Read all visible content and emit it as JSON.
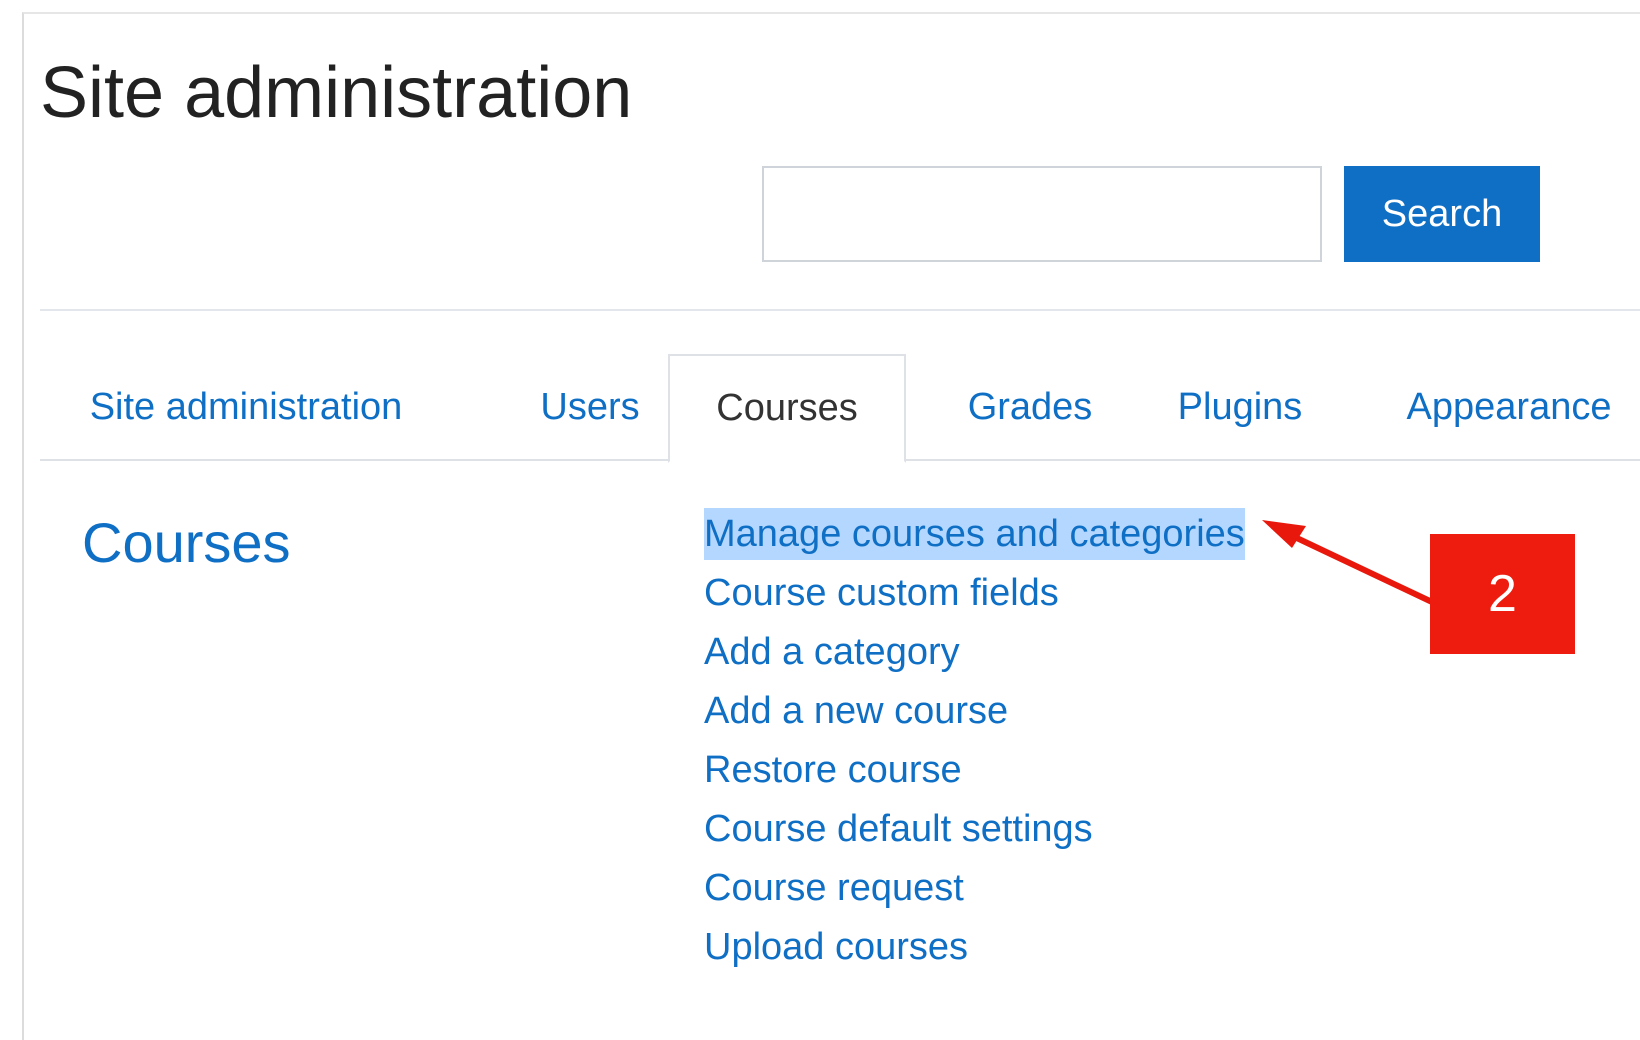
{
  "page": {
    "title": "Site administration"
  },
  "search": {
    "value": "",
    "placeholder": "",
    "button_label": "Search"
  },
  "tabs": [
    {
      "label": "Site administration",
      "active": false
    },
    {
      "label": "Users",
      "active": false
    },
    {
      "label": "Courses",
      "active": true
    },
    {
      "label": "Grades",
      "active": false
    },
    {
      "label": "Plugins",
      "active": false
    },
    {
      "label": "Appearance",
      "active": false
    }
  ],
  "section": {
    "heading": "Courses",
    "links": [
      {
        "label": "Manage courses and categories",
        "highlighted": true
      },
      {
        "label": "Course custom fields"
      },
      {
        "label": "Add a category"
      },
      {
        "label": "Add a new course"
      },
      {
        "label": "Restore course"
      },
      {
        "label": "Course default settings"
      },
      {
        "label": "Course request"
      },
      {
        "label": "Upload courses"
      }
    ]
  },
  "annotation": {
    "step_number": "2",
    "badge_color": "#ee1c0e",
    "arrow_color": "#e8190c"
  },
  "colors": {
    "accent": "#0f6fc5",
    "highlight": "#b3d7ff"
  }
}
